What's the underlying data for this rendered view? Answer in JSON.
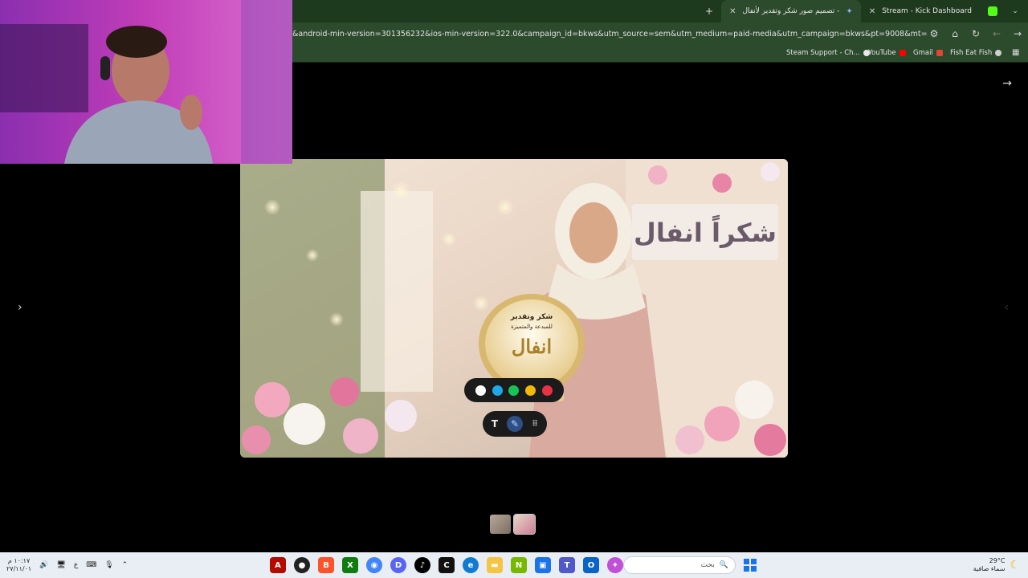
{
  "browser": {
    "tabs": [
      {
        "title": "تصميم صور شكر وتقدير لأنفال -",
        "active": true
      },
      {
        "title": "Stream - Kick Dashboard",
        "active": false
      }
    ],
    "new_tab": "+",
    "url": "&android-min-version=301356232&ios-min-version=322.0&campaign_id=bkws&utm_source=sem&utm_medium=paid-media&utm_campaign=bkws&pt=9008&mt=8&ct=p-growth-sem-b...",
    "bookmarks": [
      "Steam Support - Ch...",
      "YouTube",
      "Gmail",
      "Fish Eat Fish"
    ]
  },
  "viewer": {
    "artwork_banner_text": "شكراً انفال",
    "trophy_lines": [
      "شكر وتقدير",
      "للمبدعة والمتميزة",
      "انفال"
    ],
    "palette_colors": [
      "#ffffff",
      "#1fa7e8",
      "#19c257",
      "#f2b807",
      "#ea3145"
    ],
    "tools": [
      "T",
      "✎",
      "⠿"
    ]
  },
  "taskbar": {
    "time": "١٠:١٧ م",
    "date": "٢٧/١١/٠١",
    "lang": "ع",
    "search_placeholder": "بحث",
    "weather_temp": "29°C",
    "weather_desc": "سماء صافية"
  },
  "colors": {
    "chrome_bg": "#2c4a2c",
    "tabbar_bg": "#1e3a1e",
    "taskbar_bg": "#e9eef5",
    "accent": "#2d4f86"
  }
}
